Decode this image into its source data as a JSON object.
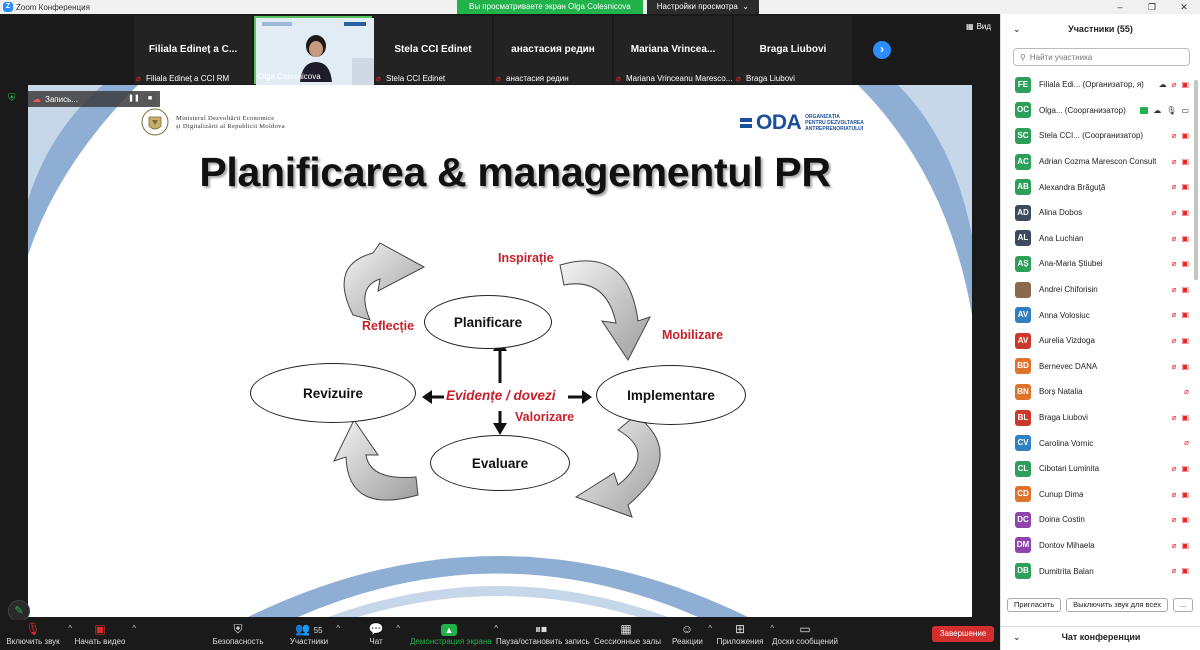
{
  "window": {
    "title": "Zoom Конференция"
  },
  "share_bar": {
    "viewing": "Вы просматриваете экран Olga Colesnicova",
    "options": "Настройки просмотра"
  },
  "view_button": "Вид",
  "tiles": [
    {
      "name": "Filiala Edineț a C...",
      "footer": "Filiala Edineț a CCI RM"
    },
    {
      "name": "",
      "footer": "Olga Colesnicova"
    },
    {
      "name": "Stela CCI Edinet",
      "footer": "Stela CCI Edinet"
    },
    {
      "name": "анастасия редин",
      "footer": "анастасия редин"
    },
    {
      "name": "Mariana  Vrinceа...",
      "footer": "Mariana Vrinceanu Marescо..."
    },
    {
      "name": "Braga Liubovi",
      "footer": "Braga Liubovi"
    }
  ],
  "recording": {
    "label": "Запись..."
  },
  "slide": {
    "ministry_line1": "Ministerul Dezvoltării Economice",
    "ministry_line2": "și Digitalizării al Republicii Moldova",
    "oda": "ODA",
    "oda_sub1": "ORGANIZAȚIA",
    "oda_sub2": "PENTRU DEZVOLTAREA",
    "oda_sub3": "ANTREPRENORIATULUI",
    "title": "Planificarea & managementul PR",
    "nodes": {
      "planificare": "Planificare",
      "revizuire": "Revizuire",
      "implementare": "Implementare",
      "evaluare": "Evaluare"
    },
    "labels": {
      "inspiratie": "Inspirație",
      "reflectie": "Reflecție",
      "mobilizare": "Mobilizare",
      "valorizare": "Valorizare",
      "evidente": "Evidențe / dovezi"
    }
  },
  "toolbar": {
    "audio": "Включить звук",
    "video": "Начать видео",
    "security": "Безопасность",
    "participants": "Участники",
    "participants_count": "55",
    "chat": "Чат",
    "share": "Демонстрация экрана",
    "pause": "Пауза/остановить запись",
    "rooms": "Сессионные залы",
    "reactions": "Реакции",
    "apps": "Приложения",
    "whiteboards": "Доски сообщений",
    "end": "Завершение"
  },
  "panel": {
    "title": "Участники (55)",
    "search_placeholder": "Найти участника",
    "invite": "Пригласить",
    "mute_all": "Выключить звук для всех",
    "more": "...",
    "chat_title": "Чат конференции",
    "participants": [
      {
        "initials": "FE",
        "name": "Filiala Edi... (Организатор, я)",
        "color": "#2e9e5b"
      },
      {
        "initials": "OC",
        "name": "Olga... (Соорганизатор)",
        "color": "#2e9e5b"
      },
      {
        "initials": "SC",
        "name": "Stela CCI... (Соорганизатор)",
        "color": "#2e9e5b"
      },
      {
        "initials": "AC",
        "name": "Adrian Cozma Marescon Consult",
        "color": "#2e9e5b"
      },
      {
        "initials": "AB",
        "name": "Alexandra Brăguță",
        "color": "#2e9e5b"
      },
      {
        "initials": "AD",
        "name": "Alina Dobos",
        "color": "#3c4a5c"
      },
      {
        "initials": "AL",
        "name": "Ana Luchian",
        "color": "#3c4a5c"
      },
      {
        "initials": "AȘ",
        "name": "Ana-Maria Știubei",
        "color": "#2e9e5b"
      },
      {
        "initials": "",
        "name": "Andrei Chiforisin",
        "color": "#8a6a4a"
      },
      {
        "initials": "AV",
        "name": "Anna Volosiuc",
        "color": "#2f7fc1"
      },
      {
        "initials": "AV",
        "name": "Aurelia Vizdoga",
        "color": "#c8392b"
      },
      {
        "initials": "BD",
        "name": "Bernevec DANA",
        "color": "#e0732c"
      },
      {
        "initials": "BN",
        "name": "Borș Natalia",
        "color": "#e0732c"
      },
      {
        "initials": "BL",
        "name": "Braga Liubovi",
        "color": "#c8392b"
      },
      {
        "initials": "CV",
        "name": "Carolina Vornic",
        "color": "#2f7fc1"
      },
      {
        "initials": "CL",
        "name": "Cibotari Luminita",
        "color": "#2e9e5b"
      },
      {
        "initials": "CD",
        "name": "Cunup Dima",
        "color": "#e0732c"
      },
      {
        "initials": "DC",
        "name": "Doina Costin",
        "color": "#8e44ad"
      },
      {
        "initials": "DM",
        "name": "Dontov Mihaela",
        "color": "#8e44ad"
      },
      {
        "initials": "DB",
        "name": "Dumitrita Balan",
        "color": "#2e9e5b"
      }
    ]
  }
}
